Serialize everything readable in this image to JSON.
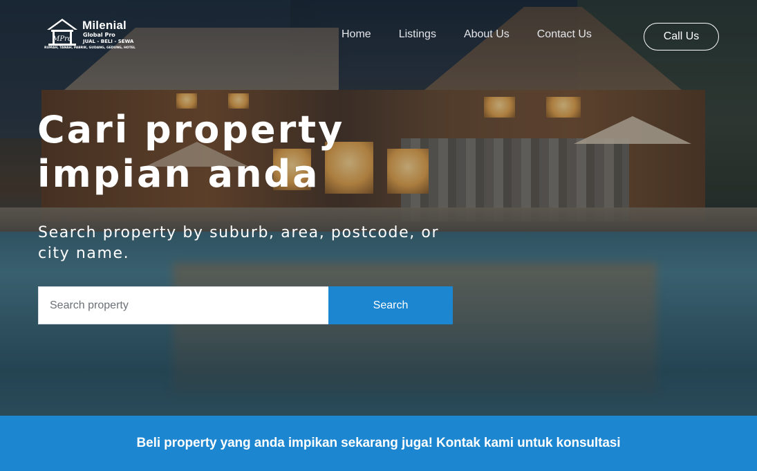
{
  "logo": {
    "brand": "Milenial",
    "subtitle": "Global Pro",
    "tagline": "JUAL - BELI - SEWA",
    "categories": "RUMAH, TANAH, PABRIK, GUDANG, GEDUNG, HOTEL",
    "mark_text": "MPro",
    "icon": "house-logo-icon"
  },
  "nav": {
    "items": [
      "Home",
      "Listings",
      "About Us",
      "Contact Us"
    ],
    "cta_label": "Call Us"
  },
  "hero": {
    "headline_line1": "Cari property",
    "headline_line2": "impian anda",
    "subline": "Search property by suburb, area, postcode, or city name.",
    "search_placeholder": "Search property",
    "search_button": "Search"
  },
  "banner": {
    "text": "Beli property yang anda impikan sekarang juga! Kontak kami untuk konsultasi"
  },
  "colors": {
    "accent": "#1d86d0",
    "text_on_dark": "#ffffff",
    "nav_text": "#e4e6ea"
  }
}
